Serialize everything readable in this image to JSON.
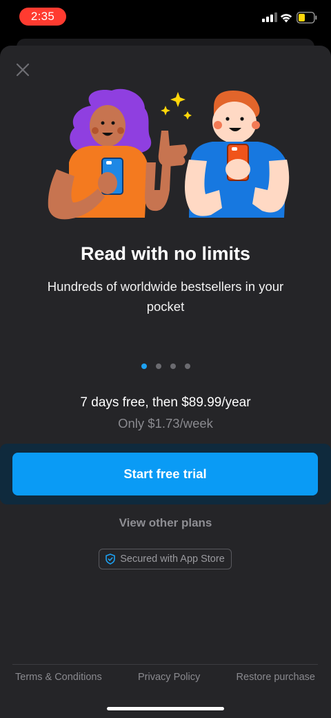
{
  "status_bar": {
    "time": "2:35"
  },
  "icons": {
    "close": "close-icon",
    "shield": "shield-check-icon",
    "signal": "signal-icon",
    "wifi": "wifi-icon",
    "battery": "battery-icon"
  },
  "onboarding": {
    "title": "Read with no limits",
    "subtitle": "Hundreds of worldwide bestsellers in your pocket",
    "page_count": 4,
    "active_page": 1
  },
  "pricing": {
    "main": "7 days free, then $89.99/year",
    "weekly": "Only $1.73/week"
  },
  "actions": {
    "start_trial": "Start free trial",
    "other_plans": "View other plans",
    "secured_badge": "Secured with App Store"
  },
  "footer": {
    "terms": "Terms & Conditions",
    "privacy": "Privacy Policy",
    "restore": "Restore purchase"
  },
  "colors": {
    "accent": "#0a9bf5",
    "background": "#252528",
    "status_time": "#ff3b30"
  }
}
